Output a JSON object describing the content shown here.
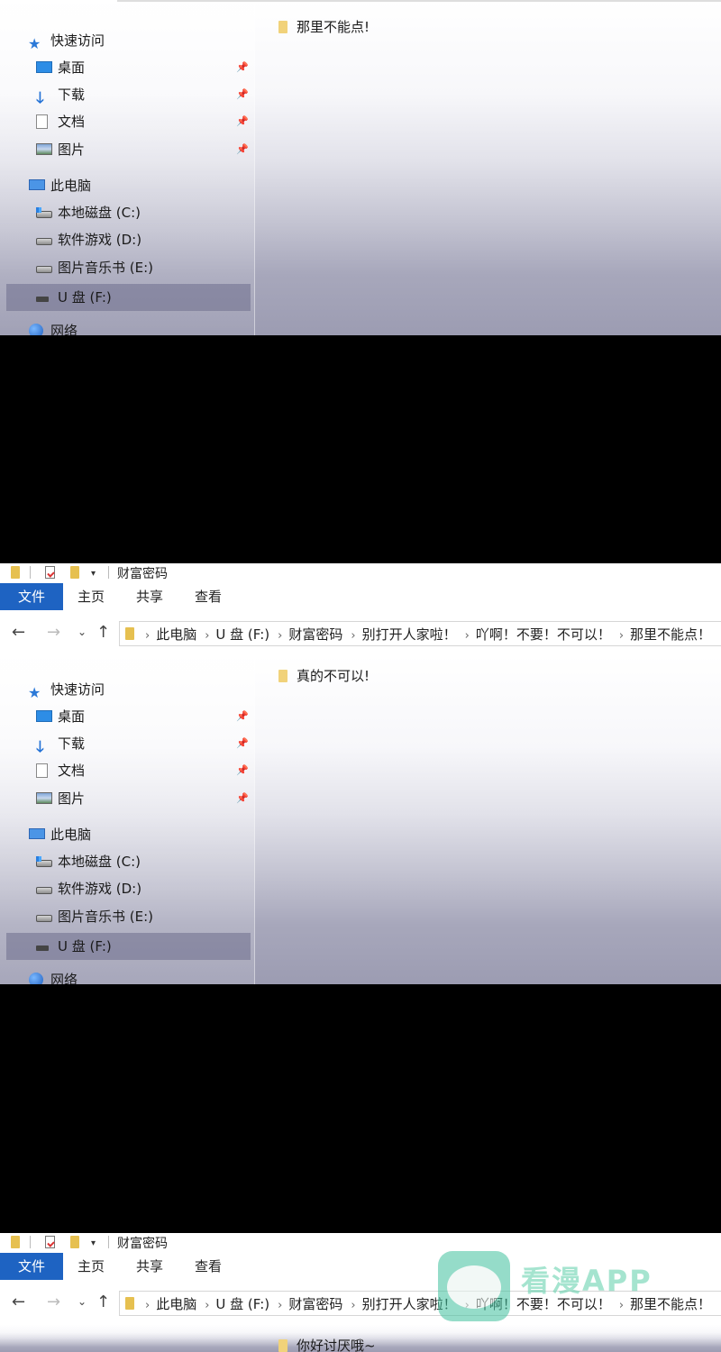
{
  "window": {
    "title": "财富密码",
    "tabs": [
      "文件",
      "主页",
      "共享",
      "查看"
    ]
  },
  "address": {
    "segments": [
      "此电脑",
      "U 盘 (F:)",
      "财富密码",
      "别打开人家啦！",
      "吖啊！不要！不可以！",
      "那里不能点！"
    ]
  },
  "sidebar": {
    "quick_access": "快速访问",
    "pinned": [
      "桌面",
      "下载",
      "文档",
      "图片"
    ],
    "this_pc": "此电脑",
    "drives": [
      "本地磁盘 (C:)",
      "软件游戏 (D:)",
      "图片音乐书 (E:)",
      "U 盘 (F:)"
    ],
    "network": "网络",
    "selected": "U 盘 (F:)"
  },
  "panels": [
    {
      "folder": "那里不能点!"
    },
    {
      "folder": "真的不可以!"
    },
    {
      "folder": "你好讨厌哦~"
    }
  ],
  "watermark": {
    "text": "看漫APP"
  },
  "colors": {
    "file_tab": "#1e63c2",
    "selection": "#7a7a96",
    "folder": "#e6c050"
  }
}
